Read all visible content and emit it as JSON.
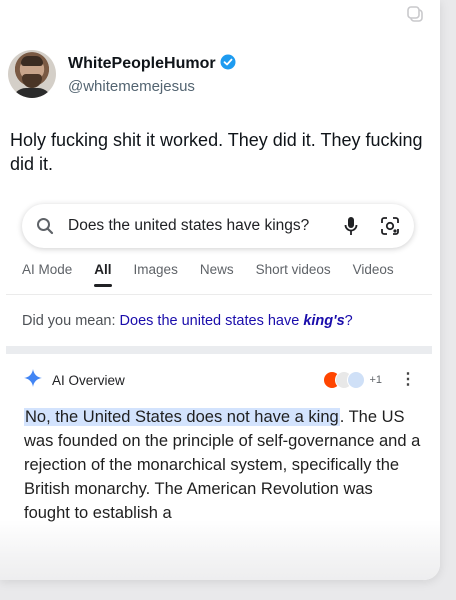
{
  "tweet": {
    "display_name": "WhitePeopleHumor",
    "handle": "@whitememejesus",
    "text": "Holy fucking shit it worked. They did it. They fucking did it.",
    "verified_icon": "verified-badge-icon"
  },
  "search": {
    "query": "Does the united states have kings?",
    "icons": [
      "search-icon",
      "mic-icon",
      "lens-icon"
    ]
  },
  "tabs": [
    {
      "label": "AI Mode",
      "active": false
    },
    {
      "label": "All",
      "active": true
    },
    {
      "label": "Images",
      "active": false
    },
    {
      "label": "News",
      "active": false
    },
    {
      "label": "Short videos",
      "active": false
    },
    {
      "label": "Videos",
      "active": false
    }
  ],
  "did_you_mean": {
    "prefix": "Did you mean:",
    "suggestion_plain": "Does the united states have",
    "suggestion_bold": "king's",
    "suffix": "?"
  },
  "ai_overview": {
    "title": "AI Overview",
    "source_count": "+1",
    "highlight": "No, the United States does not have a king",
    "body": ". The US was founded on the principle of self-governance and a rejection of the monarchical system, specifically the British monarchy. The American Revolution was fought to establish a"
  },
  "colors": {
    "link": "#1a0dab",
    "highlight": "#d3e3fd",
    "verified": "#1d9bf0",
    "gemini_blue": "#4285f4"
  }
}
